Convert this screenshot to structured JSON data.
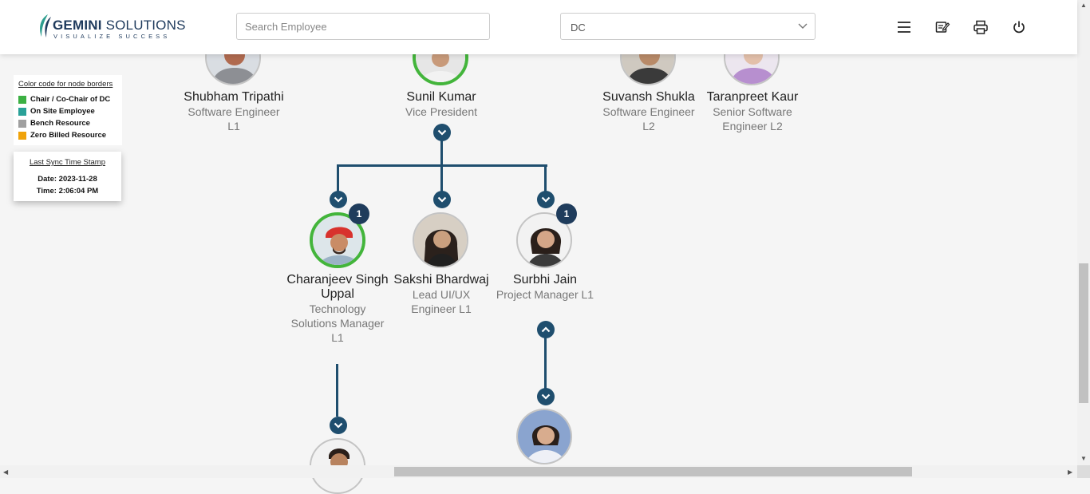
{
  "header": {
    "logo_title_bold": "GEMINI",
    "logo_title_rest": " SOLUTIONS",
    "logo_tagline": "VISUALIZE SUCCESS",
    "search_placeholder": "Search Employee",
    "department_selected": "DC",
    "icons": [
      "menu-icon",
      "edit-note-icon",
      "print-icon",
      "power-icon"
    ]
  },
  "legend": {
    "title": "Color code for node borders",
    "items": [
      {
        "label": "Chair / Co-Chair of DC",
        "color": "#3cb043"
      },
      {
        "label": "On Site Employee",
        "color": "#2aa198"
      },
      {
        "label": "Bench Resource",
        "color": "#a0a0a0"
      },
      {
        "label": "Zero Billed Resource",
        "color": "#f0a30a"
      }
    ]
  },
  "sync": {
    "title": "Last Sync Time Stamp",
    "date": "Date: 2023-11-28",
    "time": "Time: 2:06:04 PM"
  },
  "nodes": {
    "shubham": {
      "name": "Shubham Tripathi",
      "role": "Software Engineer L1"
    },
    "sunil": {
      "name": "Sunil Kumar",
      "role": "Vice President"
    },
    "suvansh": {
      "name": "Suvansh Shukla",
      "role": "Software Engineer L2"
    },
    "taranpreet": {
      "name": "Taranpreet Kaur",
      "role": "Senior Software Engineer L2"
    },
    "charanjeev": {
      "name": "Charanjeev Singh Uppal",
      "role": "Technology Solutions Manager L1",
      "badge": "1"
    },
    "sakshi": {
      "name": "Sakshi Bhardwaj",
      "role": "Lead UI/UX Engineer L1"
    },
    "surbhi": {
      "name": "Surbhi Jain",
      "role": "Project Manager L1",
      "badge": "1"
    }
  },
  "colors": {
    "accent": "#1f4e6e",
    "badge": "#1f3c5c",
    "chair_border": "#43b53b"
  }
}
